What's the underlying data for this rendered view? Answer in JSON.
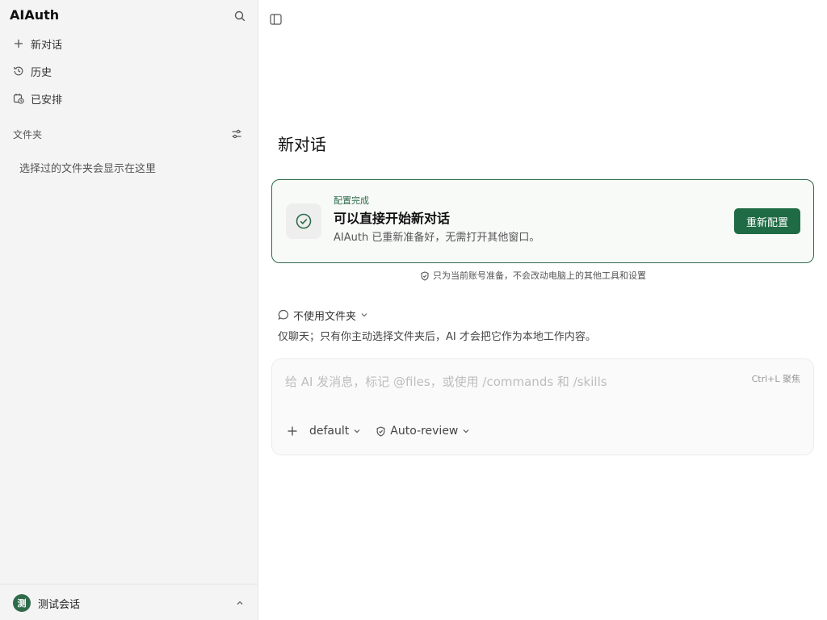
{
  "sidebar": {
    "app_title": "AIAuth",
    "nav": [
      {
        "label": "新对话",
        "icon": "plus-icon"
      },
      {
        "label": "历史",
        "icon": "history-icon"
      },
      {
        "label": "已安排",
        "icon": "calendar-clock-icon"
      }
    ],
    "folders_label": "文件夹",
    "folders_empty": "选择过的文件夹会显示在这里",
    "user": {
      "avatar_text": "测",
      "name": "测试会话"
    }
  },
  "main": {
    "title": "新对话",
    "status_card": {
      "eyebrow": "配置完成",
      "title": "可以直接开始新对话",
      "description": "AIAuth 已重新准备好，无需打开其他窗口。",
      "button_label": "重新配置"
    },
    "privacy_note": "只为当前账号准备，不会改动电脑上的其他工具和设置",
    "folder_select_label": "不使用文件夹",
    "folder_hint": "仅聊天；只有你主动选择文件夹后，AI 才会把它作为本地工作内容。",
    "composer": {
      "placeholder": "给 AI 发消息，标记 @files，或使用 /commands 和 /skills",
      "shortcut": "Ctrl+L 聚焦",
      "model_label": "default",
      "review_label": "Auto-review"
    }
  },
  "colors": {
    "accent": "#1f6b45",
    "sidebar_bg": "#f4f4f4"
  }
}
